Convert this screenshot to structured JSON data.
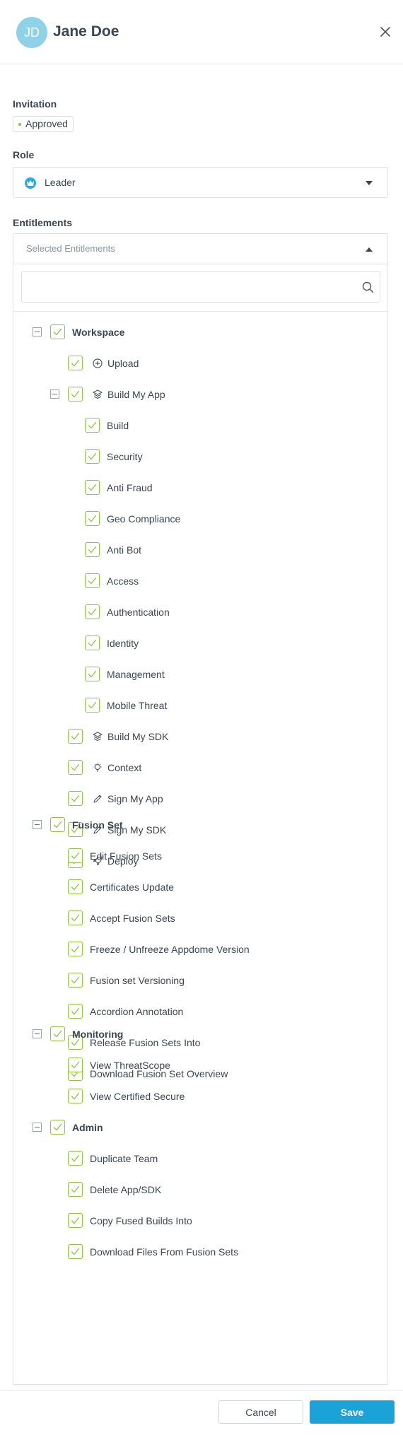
{
  "header": {
    "avatar_initials": "JD",
    "user_name": "Jane Doe",
    "close_icon": "close-icon"
  },
  "invitation": {
    "label": "Invitation",
    "status": "Approved",
    "status_color": "#8dc63f"
  },
  "role": {
    "label": "Role",
    "value": "Leader",
    "icon": "crown-icon",
    "icon_color": "#29abe2"
  },
  "entitlements": {
    "label": "Entitlements",
    "placeholder": "Selected Entitlements",
    "search_placeholder": "",
    "check_color": "#8dc63f",
    "groups": [
      {
        "label": "Workspace",
        "items": [
          {
            "label": "Upload",
            "icon": "upload-icon"
          },
          {
            "label": "Build My App",
            "icon": "build-icon",
            "children": [
              {
                "label": "Build"
              },
              {
                "label": "Security"
              },
              {
                "label": "Anti Fraud"
              },
              {
                "label": "Geo Compliance"
              },
              {
                "label": "Anti Bot"
              },
              {
                "label": "Access"
              },
              {
                "label": "Authentication"
              },
              {
                "label": "Identity"
              },
              {
                "label": "Management"
              },
              {
                "label": "Mobile Threat"
              }
            ]
          },
          {
            "label": "Build My SDK",
            "icon": "build-icon"
          },
          {
            "label": "Context",
            "icon": "lightbulb-icon"
          },
          {
            "label": "Sign My App",
            "icon": "pen-icon"
          },
          {
            "label": "Sign My SDK",
            "icon": "pen-icon"
          },
          {
            "label": "Deploy",
            "icon": "rocket-icon"
          }
        ]
      },
      {
        "label": "Fusion Set",
        "items": [
          {
            "label": "Edit Fusion Sets"
          },
          {
            "label": "Certificates Update"
          },
          {
            "label": "Accept Fusion Sets"
          },
          {
            "label": "Freeze / Unfreeze Appdome Version"
          },
          {
            "label": "Fusion set Versioning"
          },
          {
            "label": "Accordion Annotation"
          },
          {
            "label": "Release Fusion Sets Into"
          },
          {
            "label": "Download Fusion Set Overview"
          }
        ]
      },
      {
        "label": "Monitoring",
        "items": [
          {
            "label": "View ThreatScope"
          },
          {
            "label": "View Certified Secure"
          }
        ]
      },
      {
        "label": "Admin",
        "items": [
          {
            "label": "Duplicate Team"
          },
          {
            "label": "Delete App/SDK"
          },
          {
            "label": "Copy Fused Builds Into"
          },
          {
            "label": "Download Files From Fusion Sets"
          }
        ]
      }
    ]
  },
  "footer": {
    "cancel_label": "Cancel",
    "save_label": "Save",
    "save_color": "#1ba3d8"
  }
}
